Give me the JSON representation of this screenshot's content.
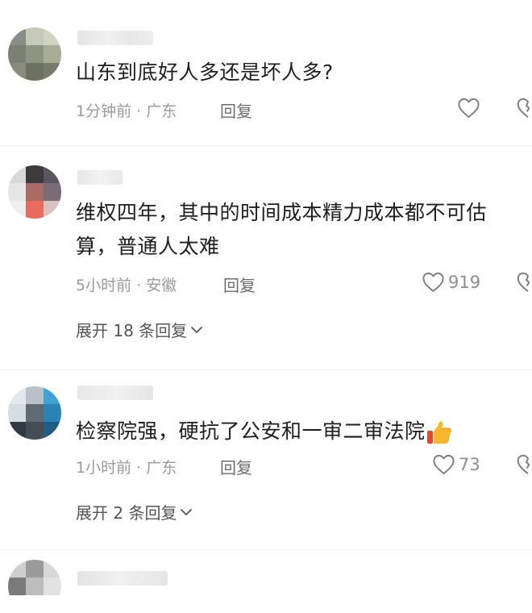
{
  "comments": [
    {
      "text": "山东到底好人多还是坏人多?",
      "time": "1分钟前",
      "location": "广东",
      "reply_label": "回复",
      "likes": ""
    },
    {
      "text": "维权四年，其中的时间成本精力成本都不可估算，普通人太难",
      "time": "5小时前",
      "location": "安徽",
      "reply_label": "回复",
      "likes": "919",
      "expand_label": "展开 18 条回复"
    },
    {
      "text": "检察院强，硬抗了公安和一审二审法院",
      "time": "1小时前",
      "location": "广东",
      "reply_label": "回复",
      "likes": "73",
      "expand_label": "展开 2 条回复"
    }
  ],
  "meta_separator": "·",
  "icons": {
    "like": "heart-outline-icon",
    "dislike": "broken-heart-icon",
    "expand": "chevron-down-icon",
    "emoji": "thumbs-up-emoji"
  },
  "colors": {
    "text": "#1e1e1e",
    "meta": "#9a9a9a",
    "icon": "#8e8e8e"
  }
}
